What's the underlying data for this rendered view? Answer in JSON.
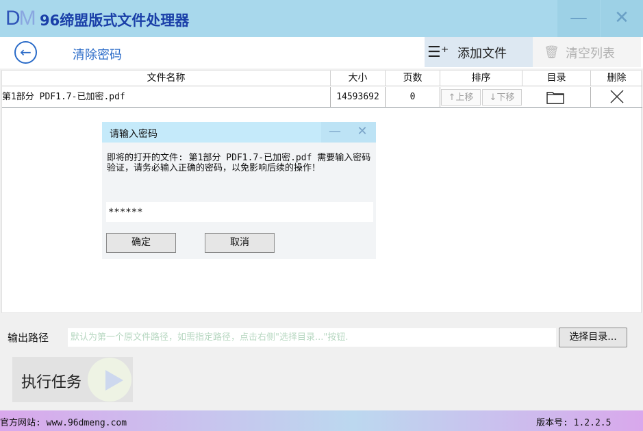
{
  "app": {
    "logo": {
      "d": "D",
      "m": "M"
    },
    "title": "96缔盟版式文件处理器",
    "minimize_glyph": "—",
    "close_glyph": "✕"
  },
  "toolbar": {
    "back_glyph": "←",
    "heading": "清除密码",
    "add_file_icon": "☰⁺",
    "add_file_label": "添加文件",
    "clear_list_icon": "🗑",
    "clear_list_label": "清空列表"
  },
  "table": {
    "columns": [
      "文件名称",
      "大小",
      "页数",
      "排序",
      "目录",
      "删除"
    ],
    "rows": [
      {
        "name": "第1部分 PDF1.7-已加密.pdf",
        "size": "14593692",
        "pages": "0",
        "move_up": "↑上移",
        "move_down": "↓下移",
        "folder_glyph": "🗀",
        "delete_glyph": "✕"
      }
    ]
  },
  "dialog": {
    "title": "请输入密码",
    "minimize_glyph": "—",
    "close_glyph": "✕",
    "message": "即将的打开的文件: 第1部分 PDF1.7-已加密.pdf 需要输入密码验证，请务必输入正确的密码，以免影响后续的操作！",
    "password_value": "******",
    "ok_label": "确定",
    "cancel_label": "取消"
  },
  "output": {
    "label": "输出路径",
    "placeholder": "默认为第一个原文件路径，如需指定路径，点击右侧\"选择目录...\"按钮.",
    "value": "",
    "choose_label": "选择目录..."
  },
  "execute": {
    "label": "执行任务"
  },
  "footer": {
    "site": "官方网站:  www.96dmeng.com",
    "version": "版本号: 1.2.2.5"
  },
  "colors": {
    "titlebar_bg": "#a8d8ec",
    "accent_blue": "#2a6bc8",
    "title_text": "#1a3fa8"
  }
}
